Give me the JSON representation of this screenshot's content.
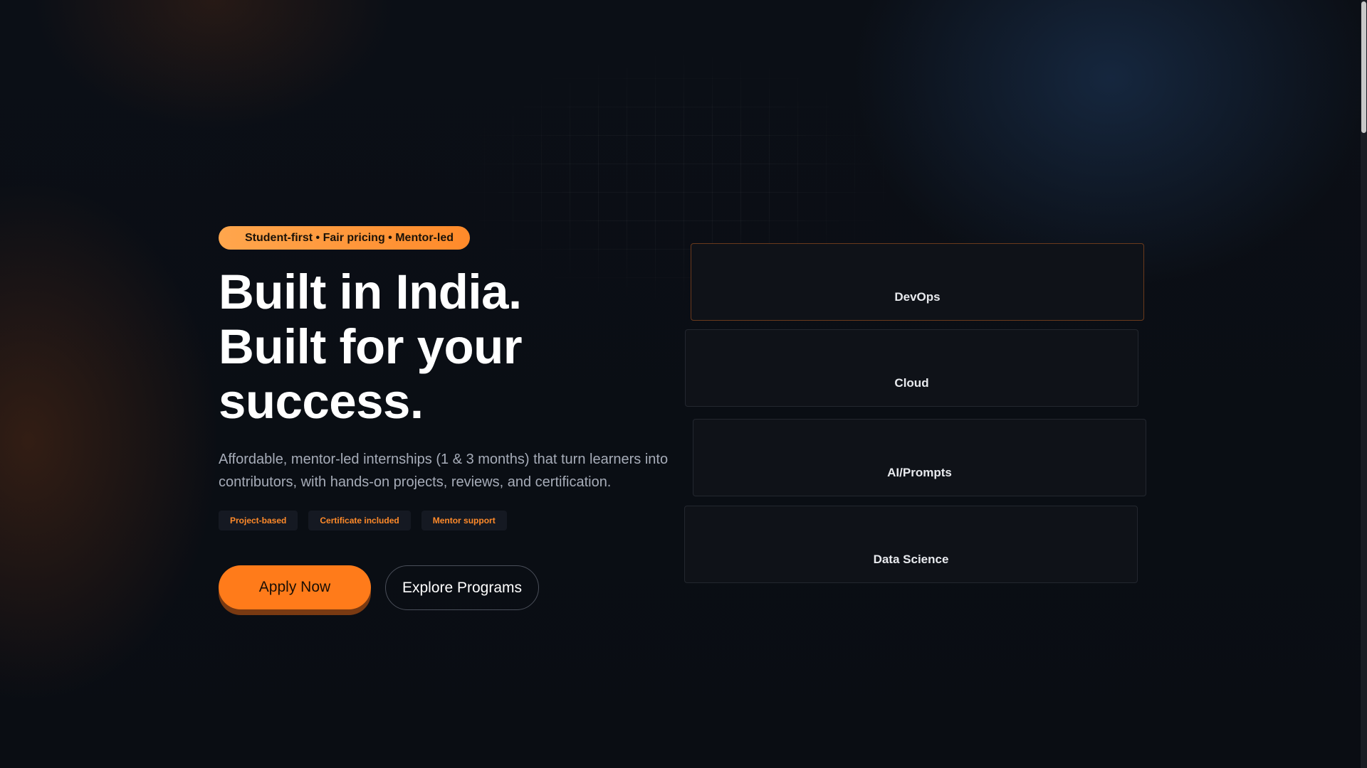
{
  "hero": {
    "badge": "Student-first • Fair pricing • Mentor-led",
    "headline_lines": [
      "Built in India.",
      "Built for your",
      "success."
    ],
    "description": "Affordable, mentor-led internships (1 & 3 months) that turn learners into contributors, with hands-on projects, reviews, and certification.",
    "tags": [
      "Project-based",
      "Certificate included",
      "Mentor support"
    ],
    "primary_button": "Apply Now",
    "secondary_button": "Explore Programs"
  },
  "program_cards": [
    {
      "label": "DevOps",
      "active": true
    },
    {
      "label": "Cloud",
      "active": false
    },
    {
      "label": "AI/Prompts",
      "active": false
    },
    {
      "label": "Data Science",
      "active": false
    }
  ],
  "colors": {
    "accent": "#ff7b1a",
    "badge_gradient_start": "#ffa64d",
    "background": "#0b0e14",
    "tag_text": "#ff8a2a"
  }
}
